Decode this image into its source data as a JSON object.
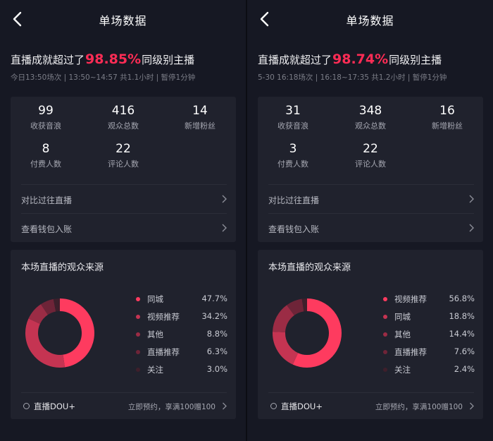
{
  "colors": {
    "accent": "#fe2c55",
    "background": "#161823",
    "card": "#20222d",
    "slice_colors": [
      "#fe3b5f",
      "#c53452",
      "#9b2c45",
      "#6e2438",
      "#3e1f2b"
    ]
  },
  "panels": [
    {
      "nav": {
        "title": "单场数据",
        "back_icon": "chevron-left-icon"
      },
      "headline": {
        "prefix": "直播成就超过了",
        "percent": "98.85%",
        "suffix": "同级别主播"
      },
      "subline": "今日13:50场次 | 13:50~14:57 共1.1小时 | 暂停1分钟",
      "stats": [
        {
          "value": "99",
          "label": "收获音浪"
        },
        {
          "value": "416",
          "label": "观众总数"
        },
        {
          "value": "14",
          "label": "新增粉丝"
        },
        {
          "value": "8",
          "label": "付费人数"
        },
        {
          "value": "22",
          "label": "评论人数"
        }
      ],
      "links": [
        {
          "label": "对比过往直播"
        },
        {
          "label": "查看钱包入账"
        }
      ],
      "source": {
        "title": "本场直播的观众来源",
        "items": [
          {
            "name": "同城",
            "value": "47.7%",
            "share": 47.7
          },
          {
            "name": "视频推荐",
            "value": "34.2%",
            "share": 34.2
          },
          {
            "name": "其他",
            "value": "8.8%",
            "share": 8.8
          },
          {
            "name": "直播推荐",
            "value": "6.3%",
            "share": 6.3
          },
          {
            "name": "关注",
            "value": "3.0%",
            "share": 3.0
          }
        ]
      },
      "promo": {
        "brand": "直播DOU+",
        "offer": "立即预约，享满100赠100"
      }
    },
    {
      "nav": {
        "title": "单场数据",
        "back_icon": "chevron-left-icon"
      },
      "headline": {
        "prefix": "直播成就超过了",
        "percent": "98.74%",
        "suffix": "同级别主播"
      },
      "subline": "5-30 16:18场次 | 16:18~17:35 共1.2小时 | 暂停1分钟",
      "stats": [
        {
          "value": "31",
          "label": "收获音浪"
        },
        {
          "value": "348",
          "label": "观众总数"
        },
        {
          "value": "16",
          "label": "新增粉丝"
        },
        {
          "value": "3",
          "label": "付费人数"
        },
        {
          "value": "22",
          "label": "评论人数"
        }
      ],
      "links": [
        {
          "label": "对比过往直播"
        },
        {
          "label": "查看钱包入账"
        }
      ],
      "source": {
        "title": "本场直播的观众来源",
        "items": [
          {
            "name": "视频推荐",
            "value": "56.8%",
            "share": 56.8
          },
          {
            "name": "同城",
            "value": "18.8%",
            "share": 18.8
          },
          {
            "name": "其他",
            "value": "14.4%",
            "share": 14.4
          },
          {
            "name": "直播推荐",
            "value": "7.6%",
            "share": 7.6
          },
          {
            "name": "关注",
            "value": "2.4%",
            "share": 2.4
          }
        ]
      },
      "promo": {
        "brand": "直播DOU+",
        "offer": "立即预约，享满100赠100"
      }
    }
  ]
}
